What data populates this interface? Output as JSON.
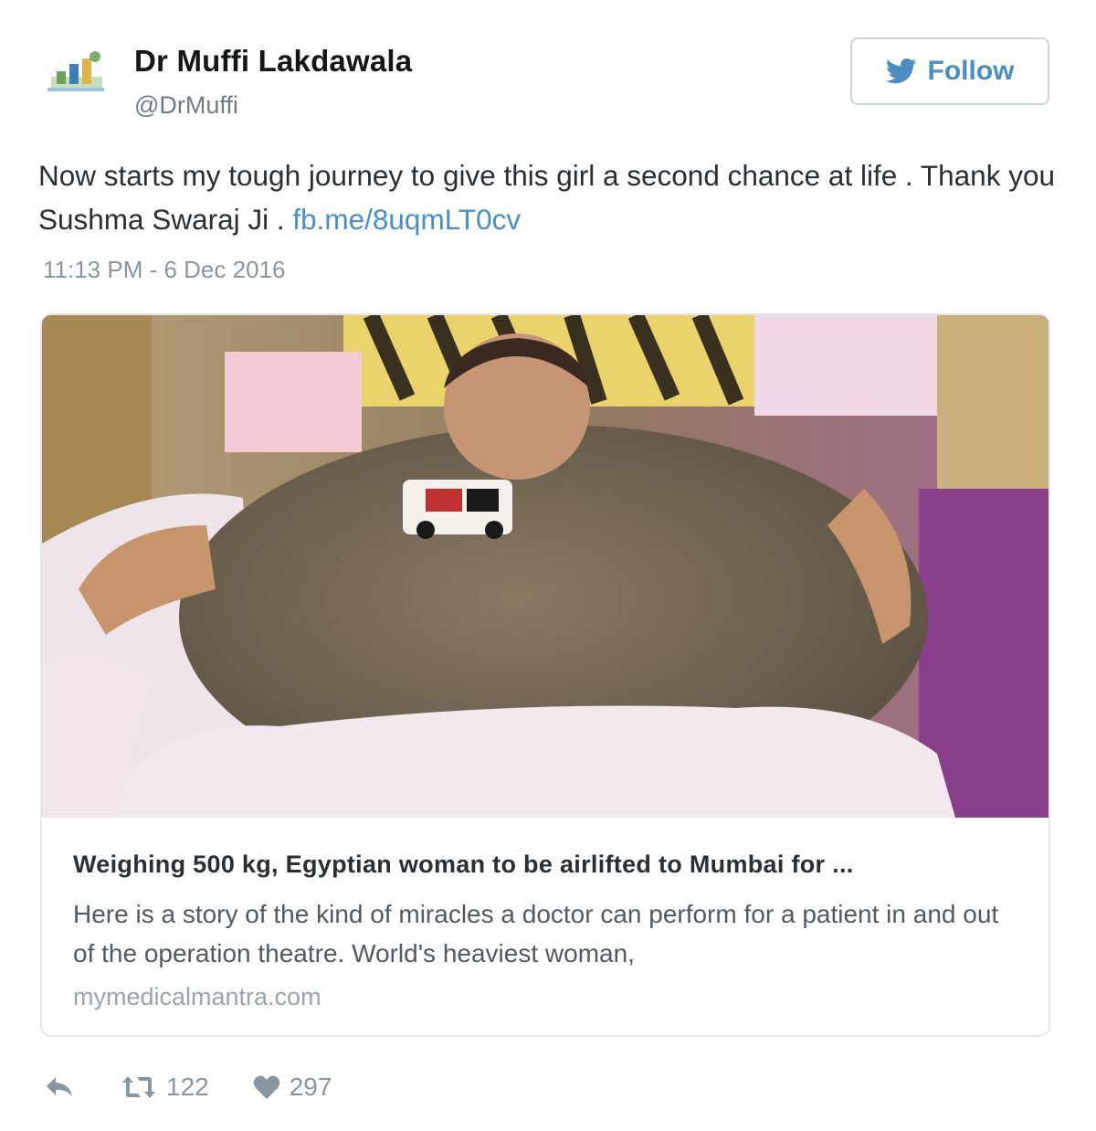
{
  "author": {
    "name": "Dr Muffi Lakdawala",
    "handle": "@DrMuffi"
  },
  "follow_button": {
    "label": "Follow",
    "icon": "twitter-bird-icon"
  },
  "tweet": {
    "text": "Now starts my tough journey to give this girl a second chance at life . Thank you Sushma Swaraj Ji . ",
    "link_text": "fb.me/8uqmLT0cv",
    "timestamp": "11:13 PM - 6 Dec 2016"
  },
  "card": {
    "image": "photo-of-woman-lying-in-bed",
    "title": "Weighing 500 kg, Egyptian woman to be airlifted to Mumbai for ...",
    "description": "Here is a story of the kind of miracles a doctor can perform for a patient in and out of the operation theatre. World's heaviest woman,",
    "domain": "mymedicalmantra.com"
  },
  "actions": {
    "reply_icon": "reply-icon",
    "retweet_icon": "retweet-icon",
    "retweet_count": "122",
    "like_icon": "heart-icon",
    "like_count": "297"
  },
  "colors": {
    "link": "#4a8ec4",
    "muted": "#8a969f",
    "border": "#e3e8ec"
  }
}
